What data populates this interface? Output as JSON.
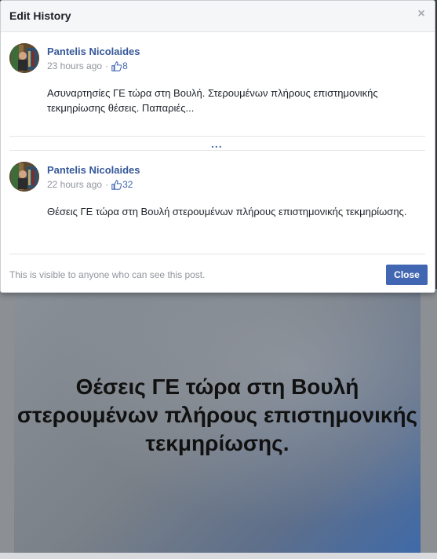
{
  "dialog": {
    "title": "Edit History",
    "close_icon": "close-icon",
    "footer_text": "This is visible to anyone who can see this post.",
    "close_label": "Close",
    "more_label": "..."
  },
  "entries": [
    {
      "author": "Pantelis Nicolaides",
      "time": "23 hours ago",
      "separator": "·",
      "likes": "8",
      "text": "Ασυναρτησίες ΓΕ τώρα στη Βουλή. Στερουμένων πλήρους επιστημονικής τεκμηρίωσης θέσεις. Παπαριές..."
    },
    {
      "author": "Pantelis Nicolaides",
      "time": "22 hours ago",
      "separator": "·",
      "likes": "32",
      "text": "Θέσεις ΓΕ τώρα στη Βουλή στερουμένων πλήρους επιστημονικής τεκμηρίωσης."
    }
  ],
  "background_post": {
    "text": "Θέσεις ΓΕ τώρα στη Βουλή στερουμένων πλήρους επιστημονικής τεκμηρίωσης."
  },
  "colors": {
    "link": "#365899",
    "accent": "#4267b2",
    "muted": "#90949c"
  }
}
